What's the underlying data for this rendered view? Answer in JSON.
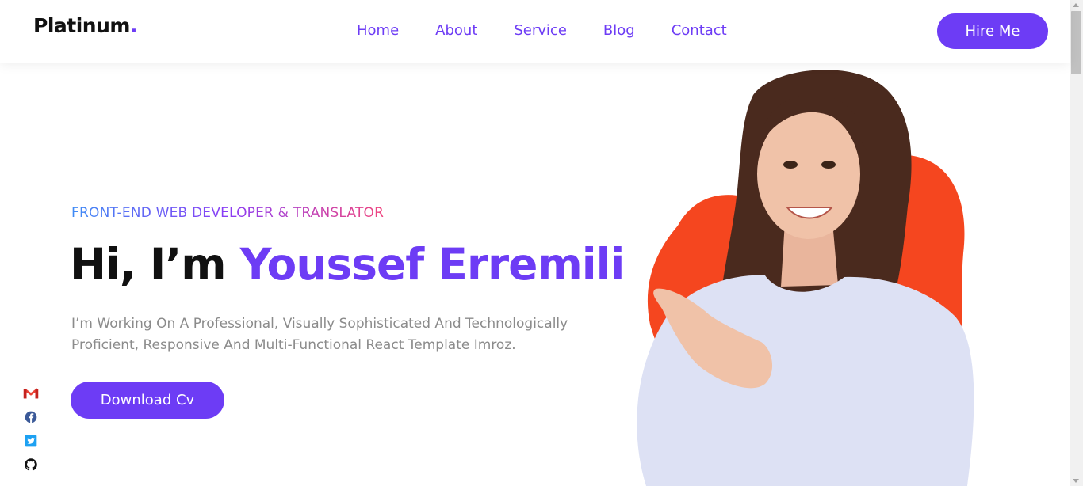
{
  "brand": {
    "name": "Platinum",
    "dot": ".",
    "accent": "#6d3cf5"
  },
  "nav": {
    "items": [
      {
        "label": "Home"
      },
      {
        "label": "About"
      },
      {
        "label": "Service"
      },
      {
        "label": "Blog"
      },
      {
        "label": "Contact"
      }
    ],
    "cta_label": "Hire Me"
  },
  "hero": {
    "subtitle": "FRONT-END WEB DEVELOPER & TRANSLATOR",
    "greeting": "Hi, I’m ",
    "name": "Youssef Erremili",
    "description": "I’m Working On A Professional, Visually Sophisticated And Technologically Proficient, Responsive And Multi-Functional React Template Imroz.",
    "button_label": "Download Cv"
  },
  "social": [
    {
      "icon": "gmail-icon"
    },
    {
      "icon": "facebook-icon"
    },
    {
      "icon": "twitter-icon"
    },
    {
      "icon": "github-icon"
    }
  ],
  "colors": {
    "primary": "#6d3cf5",
    "blob": "#f5461f",
    "heading": "#111111",
    "text": "#8b8b8b"
  }
}
